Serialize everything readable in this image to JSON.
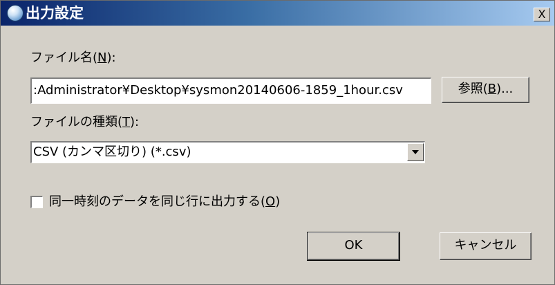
{
  "dialog": {
    "title": "出力設定",
    "close_label": "X"
  },
  "file_name": {
    "label_pre": "ファイル名(",
    "label_key": "N",
    "label_post": "):",
    "value": ":Administrator¥Desktop¥sysmon20140606-1859_1hour.csv",
    "browse_pre": "参照(",
    "browse_key": "B",
    "browse_post": ")..."
  },
  "file_type": {
    "label_pre": "ファイルの種類(",
    "label_key": "T",
    "label_post": "):",
    "selected": "CSV (カンマ区切り) (*.csv)"
  },
  "option": {
    "checked": false,
    "label_pre": "同一時刻のデータを同じ行に出力する(",
    "label_key": "O",
    "label_post": ")"
  },
  "buttons": {
    "ok": "OK",
    "cancel": "キャンセル"
  },
  "colors": {
    "title_bar_start": "#0a246a",
    "title_bar_end": "#a6caf0",
    "dialog_face": "#d4d0c8"
  }
}
